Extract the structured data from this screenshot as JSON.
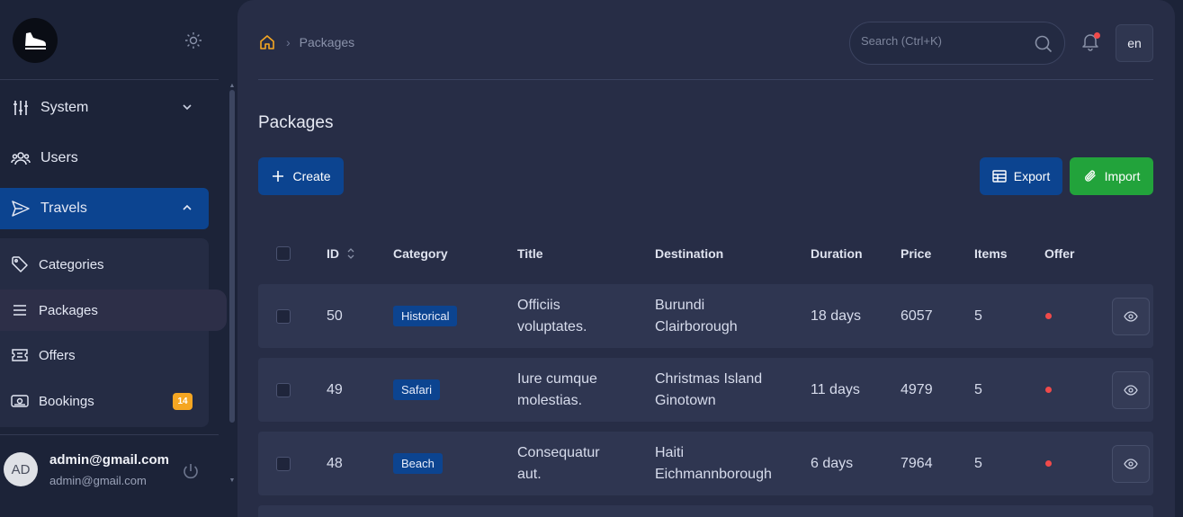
{
  "sidebar": {
    "items": [
      {
        "label": "System",
        "icon": "sliders-icon"
      },
      {
        "label": "Users",
        "icon": "users-icon"
      },
      {
        "label": "Travels",
        "icon": "send-icon"
      }
    ],
    "subitems": [
      {
        "label": "Categories",
        "icon": "tag-icon"
      },
      {
        "label": "Packages",
        "icon": "list-icon"
      },
      {
        "label": "Offers",
        "icon": "ticket-icon"
      },
      {
        "label": "Bookings",
        "icon": "wallet-icon",
        "badge": "14"
      }
    ],
    "user": {
      "initials": "AD",
      "name": "admin@gmail.com",
      "email": "admin@gmail.com"
    }
  },
  "header": {
    "breadcrumb": "Packages",
    "search_placeholder": "Search (Ctrl+K)",
    "lang": "en"
  },
  "page": {
    "title": "Packages",
    "create_label": "Create",
    "export_label": "Export",
    "import_label": "Import"
  },
  "table": {
    "headers": {
      "id": "ID",
      "category": "Category",
      "title": "Title",
      "destination": "Destination",
      "duration": "Duration",
      "price": "Price",
      "items": "Items",
      "offer": "Offer"
    },
    "rows": [
      {
        "id": "50",
        "category": "Historical",
        "title1": "Officiis",
        "title2": "voluptates.",
        "dest1": "Burundi",
        "dest2": "Clairborough",
        "duration": "18 days",
        "price": "6057",
        "items": "5"
      },
      {
        "id": "49",
        "category": "Safari",
        "title1": "Iure cumque",
        "title2": "molestias.",
        "dest1": "Christmas Island",
        "dest2": "Ginotown",
        "duration": "11 days",
        "price": "4979",
        "items": "5"
      },
      {
        "id": "48",
        "category": "Beach",
        "title1": "Consequatur",
        "title2": "aut.",
        "dest1": "Haiti",
        "dest2": "Eichmannborough",
        "duration": "6 days",
        "price": "7964",
        "items": "5"
      }
    ]
  },
  "colors": {
    "primary": "#0c4490",
    "success": "#22a33b",
    "warning": "#f5a622",
    "danger": "#f04a4a"
  }
}
